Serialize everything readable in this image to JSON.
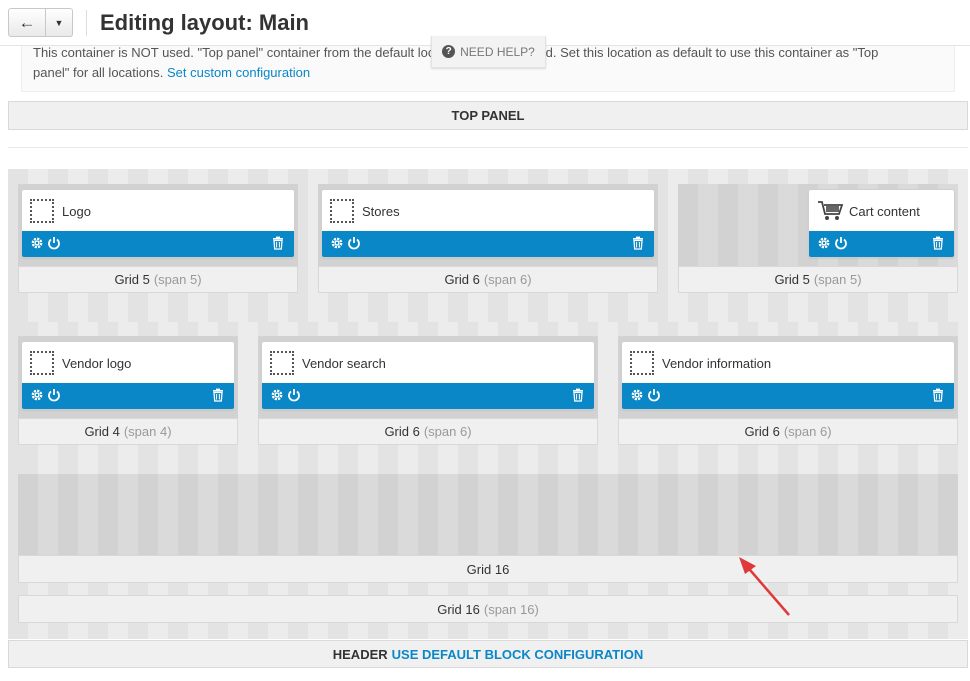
{
  "header": {
    "title": "Editing layout: Main",
    "back_icon": "arrow-left-icon",
    "caret_icon": "caret-down-icon"
  },
  "help": {
    "label": "NEED HELP?"
  },
  "notice": {
    "line1": "This container is NOT used. \"Top panel\" container from the default location is used instead. Set this location as default to use this container as \"Top",
    "line2": "panel\" for all locations.",
    "link": "Set custom configuration"
  },
  "top_panel": {
    "label": "TOP PANEL"
  },
  "row1": [
    {
      "block": "Logo",
      "grid": "Grid 5",
      "span": "(span 5)",
      "icon": "dotted-box-icon"
    },
    {
      "block": "Stores",
      "grid": "Grid 6",
      "span": "(span 6)",
      "icon": "dotted-box-icon"
    },
    {
      "block": "Cart content",
      "grid": "Grid 5",
      "span": "(span 5)",
      "icon": "cart-icon"
    }
  ],
  "row2": [
    {
      "block": "Vendor logo",
      "grid": "Grid 4",
      "span": "(span 4)",
      "icon": "dotted-box-icon"
    },
    {
      "block": "Vendor search",
      "grid": "Grid 6",
      "span": "(span 6)",
      "icon": "dotted-box-icon"
    },
    {
      "block": "Vendor information",
      "grid": "Grid 6",
      "span": "(span 6)",
      "icon": "dotted-box-icon"
    }
  ],
  "grid16": {
    "label": "Grid 16"
  },
  "outer_grid": {
    "grid": "Grid 16",
    "span": "(span 16)"
  },
  "footer": {
    "label": "HEADER",
    "link": "USE DEFAULT BLOCK CONFIGURATION"
  },
  "colors": {
    "accent": "#0a87c7",
    "arrow": "#e0393b"
  }
}
